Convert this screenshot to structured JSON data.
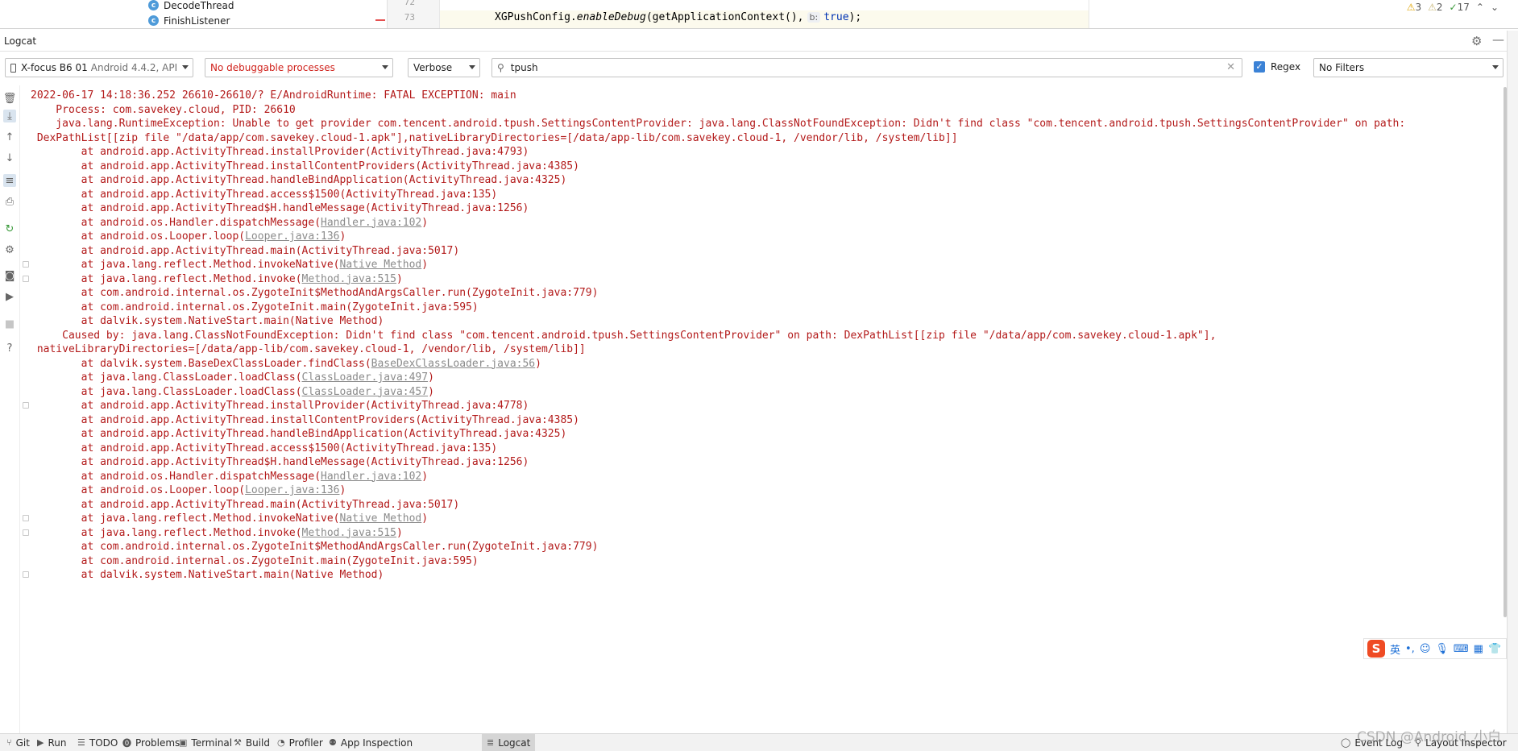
{
  "editor": {
    "tree_items": [
      {
        "label": "DecodeThread"
      },
      {
        "label": "FinishListener"
      }
    ],
    "class_badge": "c",
    "line_numbers": [
      "72",
      "73"
    ],
    "code": {
      "prefix": "XGPushConfig.",
      "method": "enableDebug",
      "args": "(getApplicationContext(),",
      "hint": "b:",
      "keyword": "true",
      "suffix": ");"
    },
    "inspections": {
      "warnings": "3",
      "weak_warnings": "2",
      "typos": "17"
    }
  },
  "logcat": {
    "title": "Logcat",
    "device": {
      "name": "X-focus B6 01",
      "detail": "Android 4.4.2, API"
    },
    "process": "No debuggable processes",
    "level": "Verbose",
    "search_value": "tpush",
    "regex_label": "Regex",
    "regex_checked": true,
    "filter": "No Filters",
    "lines": [
      {
        "text": "2022-06-17 14:18:36.252 26610-26610/? E/AndroidRuntime: FATAL EXCEPTION: main"
      },
      {
        "text": "    Process: com.savekey.cloud, PID: 26610"
      },
      {
        "text": "    java.lang.RuntimeException: Unable to get provider com.tencent.android.tpush.SettingsContentProvider: java.lang.ClassNotFoundException: Didn't find class \"com.tencent.android.tpush.SettingsContentProvider\" on path:"
      },
      {
        "text": " DexPathList[[zip file \"/data/app/com.savekey.cloud-1.apk\"],nativeLibraryDirectories=[/data/app-lib/com.savekey.cloud-1, /vendor/lib, /system/lib]]"
      },
      {
        "text": "        at android.app.ActivityThread.installProvider(ActivityThread.java:4793)"
      },
      {
        "text": "        at android.app.ActivityThread.installContentProviders(ActivityThread.java:4385)"
      },
      {
        "text": "        at android.app.ActivityThread.handleBindApplication(ActivityThread.java:4325)"
      },
      {
        "text": "        at android.app.ActivityThread.access$1500(ActivityThread.java:135)"
      },
      {
        "text": "        at android.app.ActivityThread$H.handleMessage(ActivityThread.java:1256)"
      },
      {
        "text": "        at android.os.Handler.dispatchMessage(",
        "link": "Handler.java:102",
        "after": ")"
      },
      {
        "text": "        at android.os.Looper.loop(",
        "link": "Looper.java:136",
        "after": ")"
      },
      {
        "text": "        at android.app.ActivityThread.main(ActivityThread.java:5017)"
      },
      {
        "text": "        at java.lang.reflect.Method.invokeNative(",
        "link": "Native Method",
        "after": ")"
      },
      {
        "text": "        at java.lang.reflect.Method.invoke(",
        "link": "Method.java:515",
        "after": ")"
      },
      {
        "text": "        at com.android.internal.os.ZygoteInit$MethodAndArgsCaller.run(ZygoteInit.java:779)"
      },
      {
        "text": "        at com.android.internal.os.ZygoteInit.main(ZygoteInit.java:595)"
      },
      {
        "text": "        at dalvik.system.NativeStart.main(Native Method)"
      },
      {
        "text": "     Caused by: java.lang.ClassNotFoundException: Didn't find class \"com.tencent.android.tpush.SettingsContentProvider\" on path: DexPathList[[zip file \"/data/app/com.savekey.cloud-1.apk\"],"
      },
      {
        "text": " nativeLibraryDirectories=[/data/app-lib/com.savekey.cloud-1, /vendor/lib, /system/lib]]"
      },
      {
        "text": "        at dalvik.system.BaseDexClassLoader.findClass(",
        "link": "BaseDexClassLoader.java:56",
        "after": ")"
      },
      {
        "text": "        at java.lang.ClassLoader.loadClass(",
        "link": "ClassLoader.java:497",
        "after": ")"
      },
      {
        "text": "        at java.lang.ClassLoader.loadClass(",
        "link": "ClassLoader.java:457",
        "after": ")"
      },
      {
        "text": "        at android.app.ActivityThread.installProvider(ActivityThread.java:4778)"
      },
      {
        "text": "        at android.app.ActivityThread.installContentProviders(ActivityThread.java:4385)"
      },
      {
        "text": "        at android.app.ActivityThread.handleBindApplication(ActivityThread.java:4325)"
      },
      {
        "text": "        at android.app.ActivityThread.access$1500(ActivityThread.java:135)"
      },
      {
        "text": "        at android.app.ActivityThread$H.handleMessage(ActivityThread.java:1256)"
      },
      {
        "text": "        at android.os.Handler.dispatchMessage(",
        "link": "Handler.java:102",
        "after": ")"
      },
      {
        "text": "        at android.os.Looper.loop(",
        "link": "Looper.java:136",
        "after": ")"
      },
      {
        "text": "        at android.app.ActivityThread.main(ActivityThread.java:5017)"
      },
      {
        "text": "        at java.lang.reflect.Method.invokeNative(",
        "link": "Native Method",
        "after": ")"
      },
      {
        "text": "        at java.lang.reflect.Method.invoke(",
        "link": "Method.java:515",
        "after": ")"
      },
      {
        "text": "        at com.android.internal.os.ZygoteInit$MethodAndArgsCaller.run(ZygoteInit.java:779)"
      },
      {
        "text": "        at com.android.internal.os.ZygoteInit.main(ZygoteInit.java:595)"
      },
      {
        "text": "        at dalvik.system.NativeStart.main(Native Method)"
      }
    ]
  },
  "ime": {
    "logo": "S",
    "lang": "英"
  },
  "bottom_tabs": [
    {
      "label": "Git",
      "icon": "git-icon"
    },
    {
      "label": "Run",
      "icon": "run-icon"
    },
    {
      "label": "TODO",
      "icon": "todo-icon"
    },
    {
      "label": "Problems",
      "icon": "problems-icon"
    },
    {
      "label": "Terminal",
      "icon": "terminal-icon"
    },
    {
      "label": "Build",
      "icon": "build-icon"
    },
    {
      "label": "Profiler",
      "icon": "profiler-icon"
    },
    {
      "label": "App Inspection",
      "icon": "app-inspection-icon"
    },
    {
      "label": "Logcat",
      "icon": "logcat-icon",
      "active": true
    }
  ],
  "bottom_right": {
    "event_log": "Event Log",
    "layout_inspector": "Layout Inspector"
  },
  "watermark": "CSDN @Android_小白",
  "colors": {
    "error_text": "#b31a1a",
    "link_gray": "#8b8b8b",
    "accent": "#3b82d6"
  }
}
